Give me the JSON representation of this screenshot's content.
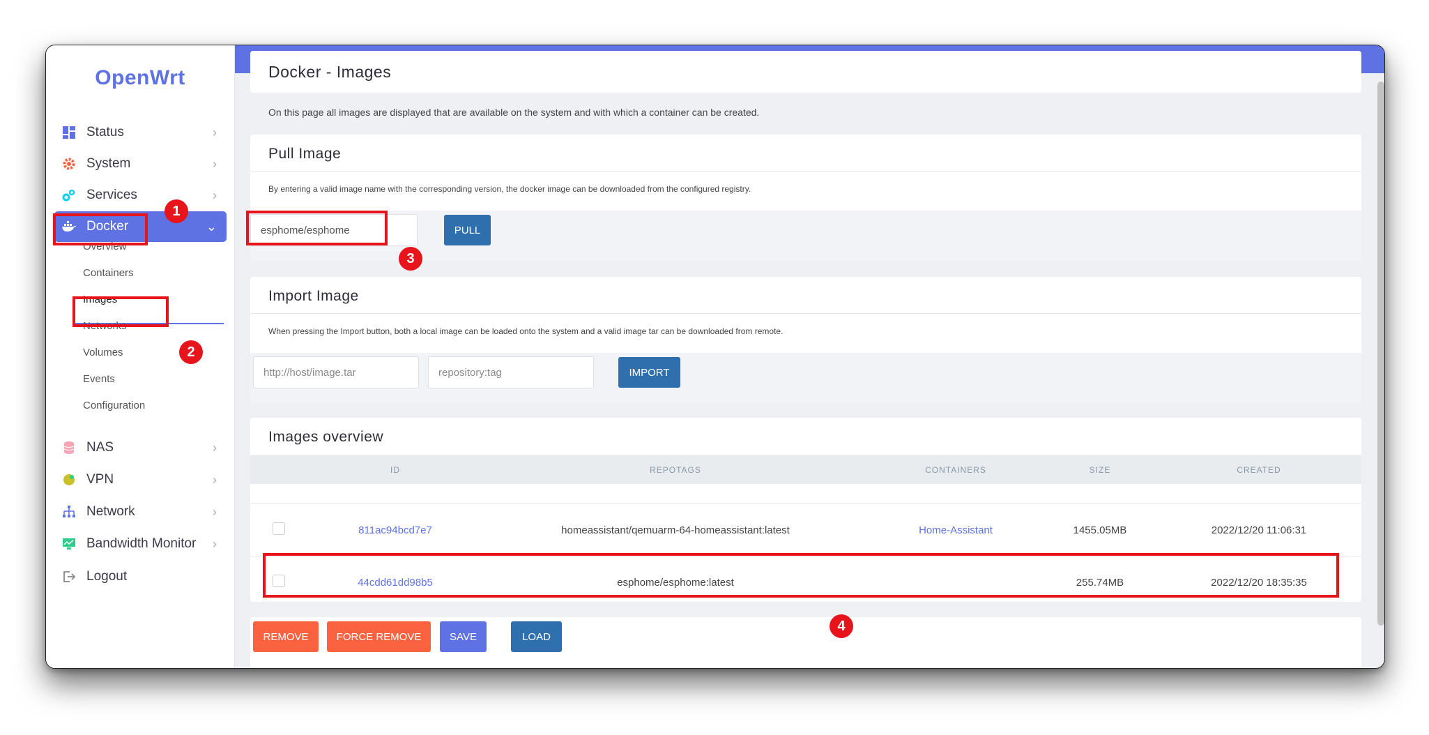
{
  "brand": "OpenWrt",
  "nav": {
    "status": "Status",
    "system": "System",
    "services": "Services",
    "docker": "Docker",
    "docker_sub": [
      "Overview",
      "Containers",
      "Images",
      "Networks",
      "Volumes",
      "Events",
      "Configuration"
    ],
    "nas": "NAS",
    "vpn": "VPN",
    "network": "Network",
    "bandwidth": "Bandwidth Monitor",
    "logout": "Logout"
  },
  "page": {
    "title": "Docker - Images",
    "description": "On this page all images are displayed that are available on the system and with which a container can be created."
  },
  "pull": {
    "title": "Pull Image",
    "description": "By entering a valid image name with the corresponding version, the docker image can be downloaded from the configured registry.",
    "value": "esphome/esphome",
    "button": "PULL"
  },
  "import": {
    "title": "Import Image",
    "description": "When pressing the Import button, both a local image can be loaded onto the system and a valid image tar can be downloaded from remote.",
    "url_placeholder": "http://host/image.tar",
    "tag_placeholder": "repository:tag",
    "button": "IMPORT"
  },
  "overview": {
    "title": "Images overview",
    "columns": [
      "ID",
      "REPOTAGS",
      "CONTAINERS",
      "SIZE",
      "CREATED"
    ],
    "rows": [
      {
        "id": "811ac94bcd7e7",
        "repotags": "homeassistant/qemuarm-64-homeassistant:latest",
        "containers": "Home-Assistant",
        "size": "1455.05MB",
        "created": "2022/12/20 11:06:31"
      },
      {
        "id": "44cdd61dd98b5",
        "repotags": "esphome/esphome:latest",
        "containers": "",
        "size": "255.74MB",
        "created": "2022/12/20 18:35:35"
      }
    ]
  },
  "actions": {
    "remove": "REMOVE",
    "force_remove": "FORCE REMOVE",
    "save": "SAVE",
    "load": "LOAD"
  },
  "annotations": [
    "1",
    "2",
    "3",
    "4"
  ],
  "colors": {
    "accent": "#5e72e4",
    "danger": "#fb6340",
    "primary_btn": "#2f6fad",
    "annotation": "#e8141c"
  }
}
